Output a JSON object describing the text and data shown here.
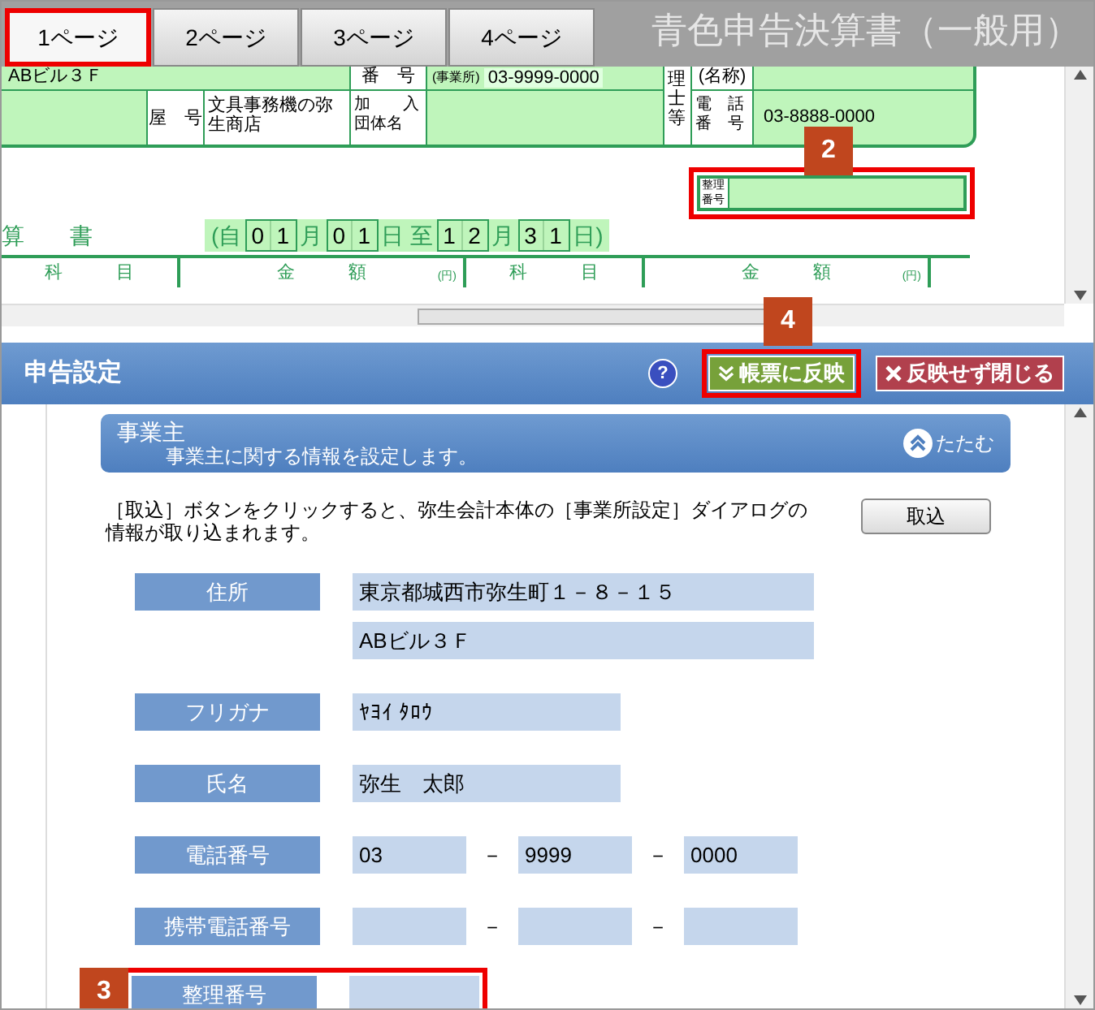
{
  "tabs": [
    {
      "label": "1ページ",
      "selected": true,
      "highlighted": true
    },
    {
      "label": "2ページ",
      "selected": false,
      "highlighted": false
    },
    {
      "label": "3ページ",
      "selected": false,
      "highlighted": false
    },
    {
      "label": "4ページ",
      "selected": false,
      "highlighted": false
    }
  ],
  "document_title": "青色申告決算書（一般用）",
  "form": {
    "address_cont": "ABビル３Ｆ",
    "phone_label": "番　号",
    "phone_sublabel": "(事業所)",
    "phone": "03-9999-0000",
    "accountant_label": "理士等",
    "accountant_name_label": "(名称)",
    "trade_name_label": "屋　号",
    "trade_name": "文具事務機の弥生商店",
    "association_label_lines": [
      "加　　入",
      "団体名"
    ],
    "accountant_phone_label_lines": [
      "電　話",
      "番　号"
    ],
    "accountant_phone": "03-8888-0000"
  },
  "reference_number": {
    "label": "整理番号",
    "highlighted": true,
    "badge": "2"
  },
  "statement": {
    "title_fragment": "算　　書",
    "period": [
      {
        "kind": "text",
        "text": "(自"
      },
      {
        "kind": "digits",
        "digits": [
          "0",
          "1"
        ]
      },
      {
        "kind": "text",
        "text": "月"
      },
      {
        "kind": "digits",
        "digits": [
          "0",
          "1"
        ]
      },
      {
        "kind": "text",
        "text": "日 至"
      },
      {
        "kind": "digits",
        "digits": [
          "1",
          "2"
        ]
      },
      {
        "kind": "text",
        "text": "月"
      },
      {
        "kind": "digits",
        "digits": [
          "3",
          "1"
        ]
      },
      {
        "kind": "text",
        "text": "日)"
      }
    ],
    "columns": [
      {
        "label": "科　　　目"
      },
      {
        "label": "金　　　額",
        "unit": "(円)"
      },
      {
        "label": "科　　　目"
      },
      {
        "label": "金　　　額",
        "unit": "(円)"
      }
    ]
  },
  "scroll_badge": "4",
  "settings_panel": {
    "title": "申告設定",
    "help_mark": "?",
    "buttons": [
      {
        "label": "帳票に反映",
        "kind": "apply",
        "highlighted": true
      },
      {
        "label": "反映せず閉じる",
        "kind": "close",
        "highlighted": false
      }
    ],
    "section": {
      "title": "事業主",
      "description": "事業主に関する情報を設定します。",
      "collapse_label": "たたむ"
    },
    "import_note": "［取込］ボタンをクリックすると、弥生会計本体の［事業所設定］ダイアログの情報が取り込まれます。",
    "import_button": "取込",
    "fields": [
      {
        "label": "住所",
        "kind": "multiline",
        "highlighted": false,
        "values": [
          "東京都城西市弥生町１－８－１５",
          "ABビル３Ｆ"
        ]
      },
      {
        "label": "フリガナ",
        "kind": "single",
        "highlighted": false,
        "value": "ﾔﾖｲ ﾀﾛｳ"
      },
      {
        "label": "氏名",
        "kind": "single",
        "highlighted": false,
        "value": "弥生　太郎"
      },
      {
        "label": "電話番号",
        "kind": "phone",
        "highlighted": false,
        "values": [
          "03",
          "9999",
          "0000"
        ],
        "separators": [
          "－",
          "－"
        ]
      },
      {
        "label": "携帯電話番号",
        "kind": "phone",
        "highlighted": false,
        "separators": [
          "－",
          "－"
        ]
      },
      {
        "label": "整理番号",
        "kind": "short",
        "highlighted": true,
        "badge": "3"
      }
    ]
  }
}
